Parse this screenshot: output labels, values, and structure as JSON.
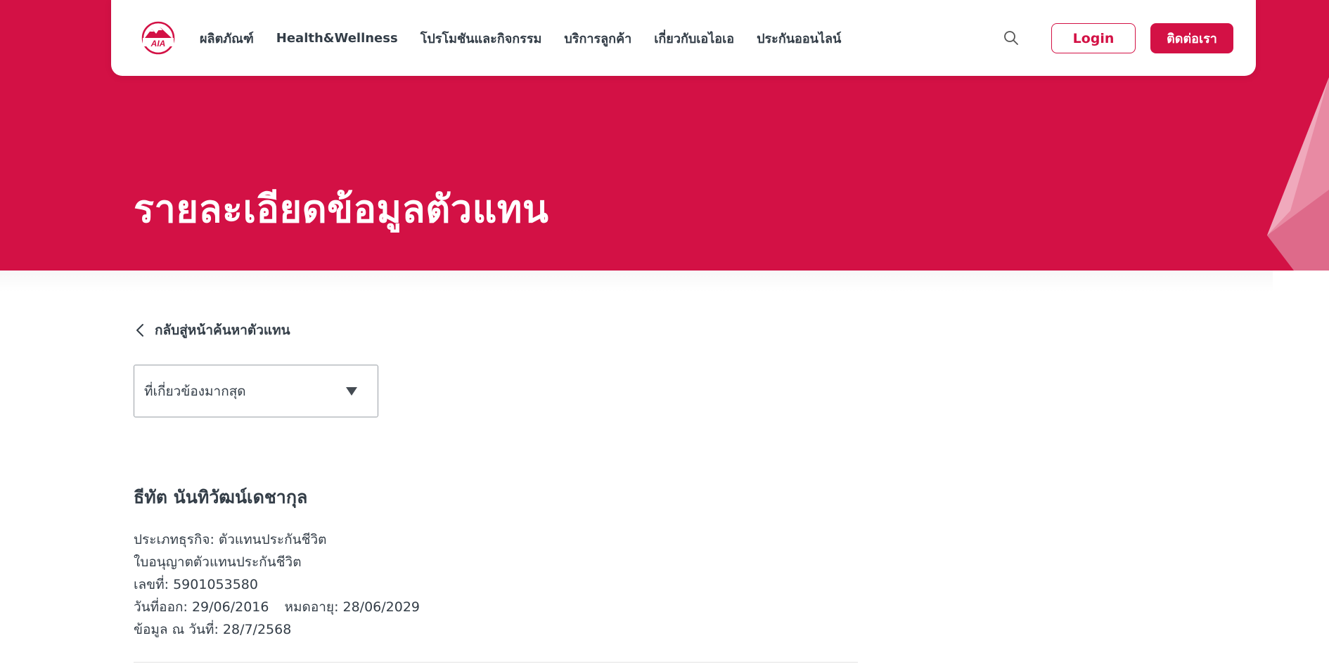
{
  "brand": {
    "logo_text": "AIA",
    "primary_color": "#d31145",
    "text_color": "#333d47"
  },
  "nav": {
    "items": [
      {
        "label": "ผลิตภัณฑ์"
      },
      {
        "label": "Health&Wellness"
      },
      {
        "label": "โปรโมชันและกิจกรรม"
      },
      {
        "label": "บริการลูกค้า"
      },
      {
        "label": "เกี่ยวกับเอไอเอ"
      },
      {
        "label": "ประกันออนไลน์"
      }
    ],
    "search_icon": "search-icon",
    "login_label": "Login",
    "contact_label": "ติดต่อเรา"
  },
  "hero": {
    "title": "รายละเอียดข้อมูลตัวแทน"
  },
  "back": {
    "label": "กลับสู่หน้าค้นหาตัวแทน",
    "icon": "chevron-left-icon"
  },
  "sort": {
    "selected": "ที่เกี่ยวข้องมากสุด",
    "icon": "triangle-down-icon"
  },
  "agent": {
    "name": "ธีทัต นันทิวัฒน์เดชากุล",
    "business_type": "ประเภทธุรกิจ: ตัวแทนประกันชีวิต",
    "license_title": "ใบอนุญาตตัวแทนประกันชีวิต",
    "license_number": "เลขที่: 5901053580",
    "issue_date": "วันที่ออก: 29/06/2016",
    "expiry_date": "หมดอายุ: 28/06/2029",
    "data_as_of": "ข้อมูล ณ วันที่: 28/7/2568"
  }
}
